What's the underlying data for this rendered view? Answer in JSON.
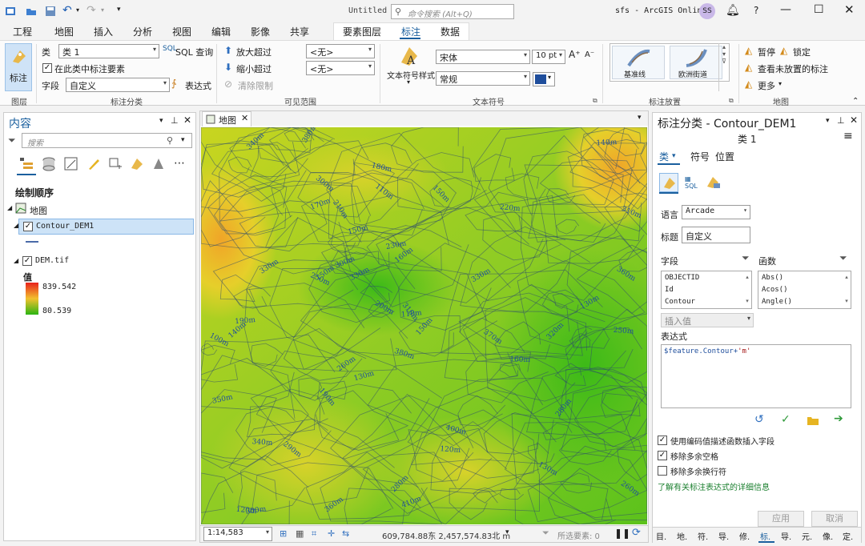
{
  "titlebar": {
    "doc_title": "Untitled",
    "search_placeholder": "命令搜索 (Alt+Q)",
    "app_title": "sfs - ArcGIS Online",
    "user_initials": "SS",
    "help": "?"
  },
  "ribbon_tabs": [
    "工程",
    "地图",
    "插入",
    "分析",
    "视图",
    "编辑",
    "影像",
    "共享",
    "要素图层",
    "标注",
    "数据"
  ],
  "ribbon": {
    "label_button": "标注",
    "layer_group": "图层",
    "class_label": "类",
    "class_value": "类 1",
    "sql_query": "SQL 查询",
    "label_features_in_class": "在此类中标注要素",
    "field_label": "字段",
    "field_value": "自定义",
    "expression": "表达式",
    "class_group": "标注分类",
    "zoom_in_beyond": "放大超过",
    "zoom_out_beyond": "缩小超过",
    "clear_limits": "清除限制",
    "zoom_in_value": "<无>",
    "zoom_out_value": "<无>",
    "visible_range_group": "可见范围",
    "text_symbol_style": "文本符号样式",
    "font_value": "宋体",
    "size_value": "10 pt",
    "style_value": "常规",
    "text_symbol_group": "文本符号",
    "placement_1": "基准线",
    "placement_2": "欧洲街道",
    "placement_group": "标注放置",
    "pause": "暂停",
    "lock": "锁定",
    "view_unplaced": "查看未放置的标注",
    "more": "更多",
    "map_group": "地图",
    "font_color": "#1f4e9c"
  },
  "contents": {
    "title": "内容",
    "search_placeholder": "搜索",
    "drawing_order": "绘制顺序",
    "map_item": "地图",
    "layer1": "Contour_DEM1",
    "layer2": "DEM.tif",
    "value_label": "值",
    "max_value": "839.542",
    "min_value": "80.539",
    "ramp_high": "#e8211b",
    "ramp_mid": "#f2c12e",
    "ramp_low": "#2bb512"
  },
  "map": {
    "tab_label": "地图",
    "labels": [
      "100m",
      "150m",
      "250m",
      "300m",
      "130m",
      "170m",
      "340m",
      "280m",
      "150m",
      "110m",
      "380m",
      "260m",
      "400m",
      "330m",
      "130m",
      "140m",
      "160m",
      "120m",
      "300m",
      "220m",
      "310m",
      "200m",
      "290m",
      "340m",
      "330m",
      "150m",
      "360m",
      "190m",
      "310m",
      "410m",
      "130m",
      "120m",
      "300m",
      "380m",
      "190m",
      "350m",
      "280m",
      "230m",
      "250m",
      "140m",
      "320m",
      "110m",
      "180m",
      "150m",
      "260m",
      "360m",
      "370m",
      "330m",
      "210m",
      "160m"
    ],
    "scale": "1:14,583",
    "coords": "609,784.88东 2,457,574.83北 m",
    "selected_features": "所选要素: 0"
  },
  "label_class_pane": {
    "title": "标注分类 - Contour_DEM1",
    "class_name": "类 1",
    "tab_class": "类",
    "tab_symbol": "符号",
    "tab_position": "位置",
    "language_label": "语言",
    "language_value": "Arcade",
    "title_label": "标题",
    "title_value": "自定义",
    "fields_label": "字段",
    "functions_label": "函数",
    "fields": [
      "OBJECTID",
      "Id",
      "Contour"
    ],
    "functions": [
      "Abs()",
      "Acos()",
      "Angle()"
    ],
    "insert_values": "插入值",
    "expression_label": "表达式",
    "expression_part1": "$feature.Contour+",
    "expression_part2": "'m'",
    "opt1": "使用编码值描述函数插入字段",
    "opt2": "移除多余空格",
    "opt3": "移除多余换行符",
    "learn_more": "了解有关标注表达式的详细信息",
    "apply": "应用",
    "cancel": "取消",
    "bottom_tabs": [
      "目.",
      "地.",
      "符.",
      "导.",
      "修.",
      "标.",
      "导.",
      "元.",
      "像.",
      "定."
    ]
  }
}
